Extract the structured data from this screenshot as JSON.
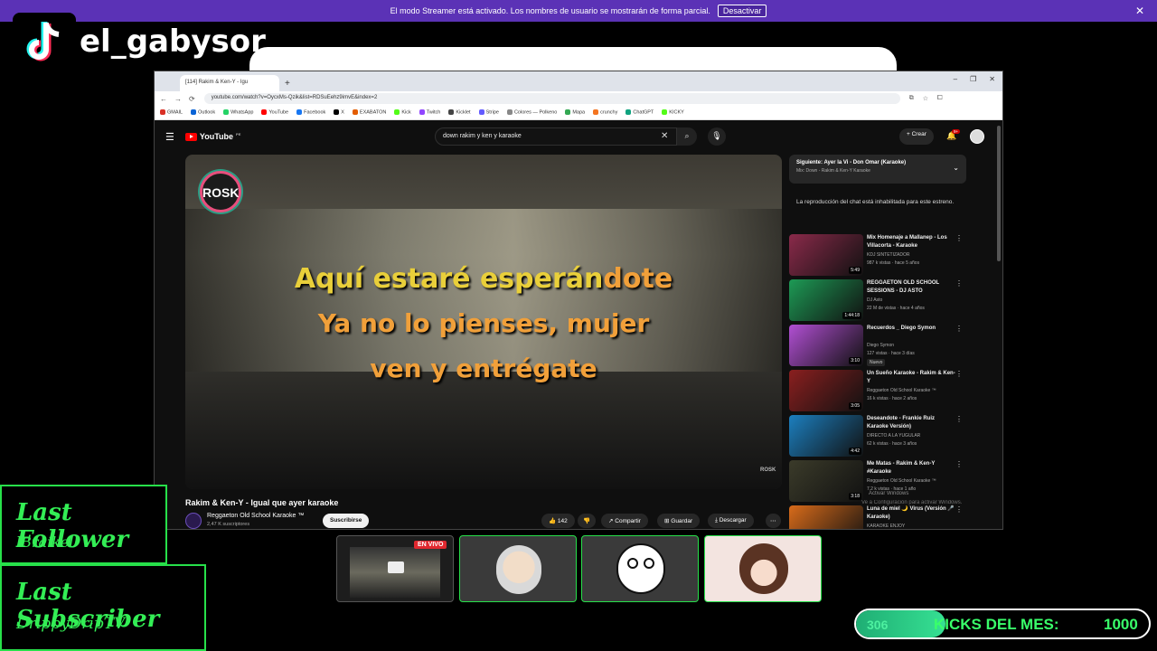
{
  "banner": {
    "message": "El modo Streamer está activado. Los nombres de usuario se mostrarán de forma parcial.",
    "button": "Desactivar"
  },
  "overlay": {
    "handle": "el_gabysor",
    "last_follower_label": "Last Follower",
    "last_follower_name": "lBraikel",
    "last_subscriber_label": "Last Subscriber",
    "last_subscriber_name": "DrippyDripTV",
    "live_badge": "EN VIVO",
    "kicks_current": "306",
    "kicks_label": "KICKS DEL MES:",
    "kicks_goal": "1000",
    "kicks_progress": 0.306,
    "accent_color": "#33ee55"
  },
  "browser": {
    "tab_title": "[114] Rakim & Ken-Y - Igu",
    "url": "youtube.com/watch?v=OycxMs-Qzik&list=RDSuEehz9imvE&index=2",
    "bookmarks": [
      {
        "label": "GMAIL",
        "color": "#d93025"
      },
      {
        "label": "Outlook",
        "color": "#0a64d6"
      },
      {
        "label": "WhatsApp",
        "color": "#25d366"
      },
      {
        "label": "YouTube",
        "color": "#ff0000"
      },
      {
        "label": "Facebook",
        "color": "#1877f2"
      },
      {
        "label": "X",
        "color": "#000000"
      },
      {
        "label": "EXABATON",
        "color": "#e35d00"
      },
      {
        "label": "Kick",
        "color": "#53fc18"
      },
      {
        "label": "Twitch",
        "color": "#9146ff"
      },
      {
        "label": "Kicklet",
        "color": "#444444"
      },
      {
        "label": "Stripe",
        "color": "#635bff"
      },
      {
        "label": "Colores — Polkeno",
        "color": "#888888"
      },
      {
        "label": "Mapa",
        "color": "#34a853"
      },
      {
        "label": "crunchy",
        "color": "#f47521"
      },
      {
        "label": "ChatGPT",
        "color": "#10a37f"
      },
      {
        "label": "KICKY",
        "color": "#53fc18"
      }
    ]
  },
  "youtube": {
    "logo": "YouTube",
    "logo_suffix": "PE",
    "search_query": "down rakim y ken y karaoke",
    "create_label": "Crear",
    "bell_badge": "9+",
    "video": {
      "channel_logo": "ROSK",
      "lyric1_sung": "Aquí estaré esperán",
      "lyric1_rest": "dote",
      "lyric2": "Ya no lo pienses, mujer",
      "lyric3": "ven y entrégate",
      "watermark": "ROSK",
      "title": "Rakim & Ken-Y - Igual que ayer karaoke",
      "channel": "Reggaeton Old School Karaoke ™",
      "subscribers": "2,47 K suscriptores",
      "subscribe": "Suscribirse",
      "likes": "142",
      "share": "Compartir",
      "save": "Guardar",
      "download": "Descargar"
    },
    "next": {
      "title": "Siguiente: Ayer la Vi - Don Omar (Karaoke)",
      "subtitle": "Mix: Down - Rakim & Ken-Y Karaoke"
    },
    "chat_disabled": "La reproducción del chat está inhabilitada para este estreno.",
    "recommendations": [
      {
        "title": "Mix Homenaje a Mallanep - Los Villacorta - Karaoke",
        "channel": "KDJ SINTETIZADOR",
        "meta": "987 k vistas · hace 5 años",
        "duration": "5:49",
        "color": "#8a2a4a",
        "badge": ""
      },
      {
        "title": "REGGAETON OLD SCHOOL SESSIONS - DJ ASTO",
        "channel": "DJ Asto",
        "meta": "22 M de vistas · hace 4 años",
        "duration": "1:44:18",
        "color": "#1d9a55",
        "badge": ""
      },
      {
        "title": "Recuerdos _ Diego Symon",
        "channel": "Diego Symon",
        "meta": "127 vistas · hace 3 días",
        "duration": "3:10",
        "color": "#b14fd3",
        "badge": "Nuevo"
      },
      {
        "title": "Un Sueño Karaoke - Rakim & Ken-Y",
        "channel": "Reggaeton Old School Karaoke ™",
        "meta": "16 k vistas · hace 2 años",
        "duration": "3:05",
        "color": "#8a1f1f",
        "badge": ""
      },
      {
        "title": "Deseandote - Frankie Ruiz Karaoke Versión)",
        "channel": "DIRECTO A LA YUGULAR",
        "meta": "62 k vistas · hace 3 años",
        "duration": "4:42",
        "color": "#1c7fbf",
        "badge": ""
      },
      {
        "title": "Me Matas - Rakim & Ken-Y #Karaoke",
        "channel": "Reggaeton Old School Karaoke ™",
        "meta": "7,2 k vistas · hace 1 año",
        "duration": "3:18",
        "color": "#3b3b2a",
        "badge": ""
      },
      {
        "title": "Luna de miel 🌙 Virus (Versión 🎤 Karaoke)",
        "channel": "KARAOKE ENJOY",
        "meta": "",
        "duration": "",
        "color": "#d86b1a",
        "badge": ""
      }
    ],
    "windows_activate": "Activar Windows",
    "windows_activate_sub": "Ve a Configuración para activar Windows."
  }
}
